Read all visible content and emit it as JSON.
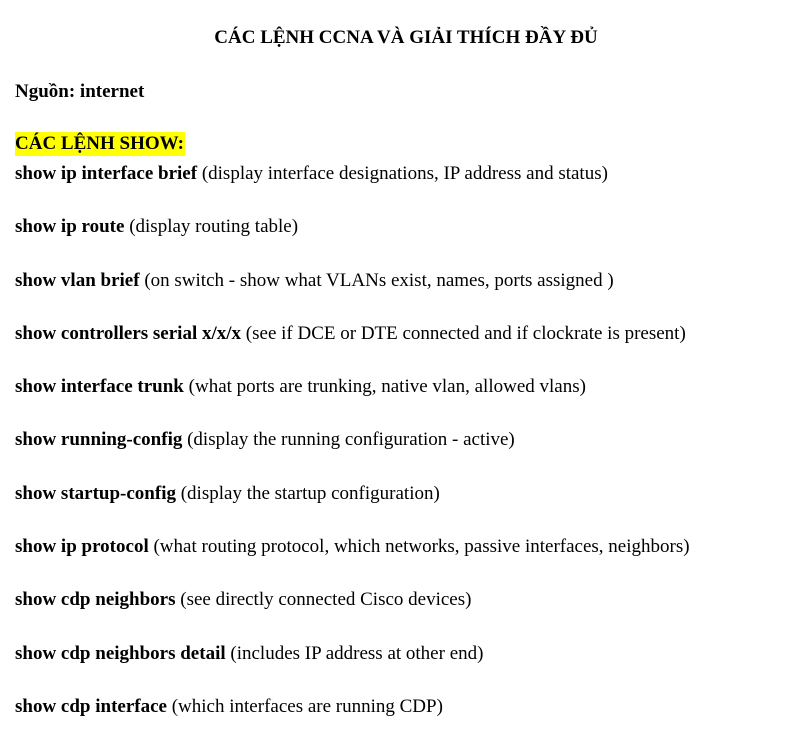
{
  "document": {
    "title": "CÁC LỆNH CCNA VÀ GIẢI THÍCH ĐẦY ĐỦ",
    "source": "Nguồn: internet",
    "section_heading": "CÁC LỆNH SHOW:",
    "commands": [
      {
        "command": "show ip interface brief",
        "description": " (display interface designations, IP address and status)"
      },
      {
        "command": "show ip route",
        "description": " (display routing table)"
      },
      {
        "command": "show vlan brief",
        "description": " (on switch - show what VLANs exist, names, ports assigned )"
      },
      {
        "command": "show controllers serial x/x/x",
        "description": " (see if DCE or DTE connected and if clockrate is present)"
      },
      {
        "command": "show interface trunk",
        "description": " (what ports are trunking, native vlan, allowed vlans)"
      },
      {
        "command": "show running-config",
        "description": " (display the running configuration - active)"
      },
      {
        "command": "show startup-config",
        "description": " (display the startup configuration)"
      },
      {
        "command": "show ip protocol",
        "description": " (what routing protocol, which networks, passive interfaces, neighbors)"
      },
      {
        "command": "show cdp neighbors",
        "description": " (see directly connected Cisco devices)"
      },
      {
        "command": "show cdp neighbors detail",
        "description": " (includes IP address at other end)"
      },
      {
        "command": "show cdp interface",
        "description": " (which interfaces are running CDP)"
      }
    ],
    "highlight_color": "#ffff00"
  }
}
